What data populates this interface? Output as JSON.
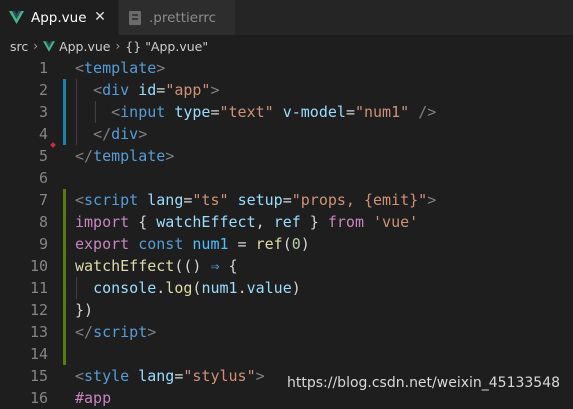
{
  "tabs": [
    {
      "label": "App.vue",
      "icon": "vue-logo-icon",
      "active": true
    },
    {
      "label": ".prettierrc",
      "icon": "file-icon",
      "active": false
    }
  ],
  "breadcrumb": {
    "folder": "src",
    "file": "App.vue",
    "symbol_icon": "{}",
    "symbol": "\"App.vue\""
  },
  "lines": [
    {
      "n": "1",
      "tokens": [
        [
          "punc",
          "<"
        ],
        [
          "tag",
          "template"
        ],
        [
          "punc",
          ">"
        ]
      ]
    },
    {
      "n": "2",
      "tokens": [
        [
          "plain",
          "  "
        ],
        [
          "punc",
          "<"
        ],
        [
          "tag",
          "div"
        ],
        [
          "plain",
          " "
        ],
        [
          "attr",
          "id"
        ],
        [
          "plain",
          "="
        ],
        [
          "str",
          "\"app\""
        ],
        [
          "punc",
          ">"
        ]
      ]
    },
    {
      "n": "3",
      "tokens": [
        [
          "plain",
          "    "
        ],
        [
          "punc",
          "<"
        ],
        [
          "tag",
          "input"
        ],
        [
          "plain",
          " "
        ],
        [
          "attr",
          "type"
        ],
        [
          "plain",
          "="
        ],
        [
          "str",
          "\"text\""
        ],
        [
          "plain",
          " "
        ],
        [
          "attr",
          "v-model"
        ],
        [
          "plain",
          "="
        ],
        [
          "str",
          "\"num1\""
        ],
        [
          "plain",
          " "
        ],
        [
          "punc",
          "/>"
        ]
      ]
    },
    {
      "n": "4",
      "tokens": [
        [
          "plain",
          "  "
        ],
        [
          "punc",
          "</"
        ],
        [
          "tag",
          "div"
        ],
        [
          "punc",
          ">"
        ]
      ]
    },
    {
      "n": "5",
      "tokens": [
        [
          "punc",
          "</"
        ],
        [
          "tag",
          "template"
        ],
        [
          "punc",
          ">"
        ]
      ]
    },
    {
      "n": "6",
      "tokens": []
    },
    {
      "n": "7",
      "tokens": [
        [
          "punc",
          "<"
        ],
        [
          "tag",
          "script"
        ],
        [
          "plain",
          " "
        ],
        [
          "attr",
          "lang"
        ],
        [
          "plain",
          "="
        ],
        [
          "str",
          "\"ts\""
        ],
        [
          "plain",
          " "
        ],
        [
          "attr",
          "setup"
        ],
        [
          "plain",
          "="
        ],
        [
          "str",
          "\"props, {emit}\""
        ],
        [
          "punc",
          ">"
        ]
      ]
    },
    {
      "n": "8",
      "tokens": [
        [
          "kw",
          "import"
        ],
        [
          "plain",
          " { "
        ],
        [
          "var",
          "watchEffect"
        ],
        [
          "plain",
          ", "
        ],
        [
          "var",
          "ref"
        ],
        [
          "plain",
          " } "
        ],
        [
          "kw",
          "from"
        ],
        [
          "plain",
          " "
        ],
        [
          "str",
          "'vue'"
        ]
      ]
    },
    {
      "n": "9",
      "tokens": [
        [
          "kw",
          "export"
        ],
        [
          "plain",
          " "
        ],
        [
          "kw2",
          "const"
        ],
        [
          "plain",
          " "
        ],
        [
          "const",
          "num1"
        ],
        [
          "plain",
          " = "
        ],
        [
          "fn",
          "ref"
        ],
        [
          "plain",
          "("
        ],
        [
          "num",
          "0"
        ],
        [
          "plain",
          ")"
        ]
      ]
    },
    {
      "n": "10",
      "tokens": [
        [
          "fn",
          "watchEffect"
        ],
        [
          "plain",
          "(() "
        ],
        [
          "kw2",
          "⇒"
        ],
        [
          "plain",
          " {"
        ]
      ]
    },
    {
      "n": "11",
      "tokens": [
        [
          "plain",
          "  "
        ],
        [
          "var",
          "console"
        ],
        [
          "plain",
          "."
        ],
        [
          "fn",
          "log"
        ],
        [
          "plain",
          "("
        ],
        [
          "var",
          "num1"
        ],
        [
          "plain",
          "."
        ],
        [
          "var",
          "value"
        ],
        [
          "plain",
          ")"
        ]
      ]
    },
    {
      "n": "12",
      "tokens": [
        [
          "plain",
          "})"
        ]
      ]
    },
    {
      "n": "13",
      "tokens": [
        [
          "punc",
          "</"
        ],
        [
          "tag",
          "script"
        ],
        [
          "punc",
          ">"
        ]
      ]
    },
    {
      "n": "14",
      "tokens": []
    },
    {
      "n": "15",
      "tokens": [
        [
          "punc",
          "<"
        ],
        [
          "tag",
          "style"
        ],
        [
          "plain",
          " "
        ],
        [
          "attr",
          "lang"
        ],
        [
          "plain",
          "="
        ],
        [
          "str",
          "\"stylus\""
        ],
        [
          "punc",
          ">"
        ]
      ]
    },
    {
      "n": "16",
      "tokens": [
        [
          "kw",
          "#app"
        ]
      ]
    }
  ],
  "watermark": "https://blog.csdn.net/weixin_45133548",
  "colors": {
    "background": "#1e1e1e",
    "tabbar": "#252526",
    "modified_bar": "#1b81a8",
    "added_bar": "#587c0c",
    "deleted_marker": "#c3303a"
  }
}
